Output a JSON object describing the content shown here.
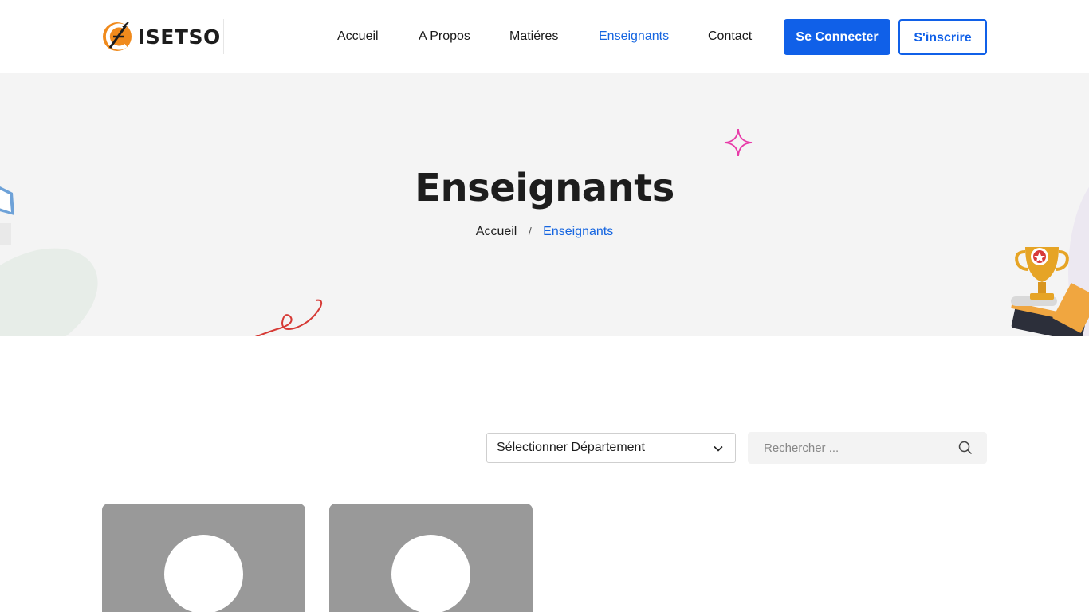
{
  "brand": {
    "name": "ISETSO",
    "accent": "#1060e8",
    "logo_orange": "#f08a1c"
  },
  "nav": {
    "items": [
      {
        "label": "Accueil",
        "active": false
      },
      {
        "label": "A Propos",
        "active": false
      },
      {
        "label": "Matiéres",
        "active": false
      },
      {
        "label": "Enseignants",
        "active": true
      },
      {
        "label": "Contact",
        "active": false
      }
    ],
    "login_label": "Se Connecter",
    "signup_label": "S'inscrire"
  },
  "hero": {
    "title": "Enseignants",
    "breadcrumb": {
      "home": "Accueil",
      "separator": "/",
      "current": "Enseignants"
    }
  },
  "filters": {
    "department_select": {
      "selected": "Sélectionner Département"
    },
    "search": {
      "placeholder": "Rechercher ...",
      "value": ""
    }
  },
  "teachers": [
    {
      "avatar": "placeholder-avatar"
    },
    {
      "avatar": "placeholder-avatar"
    }
  ]
}
